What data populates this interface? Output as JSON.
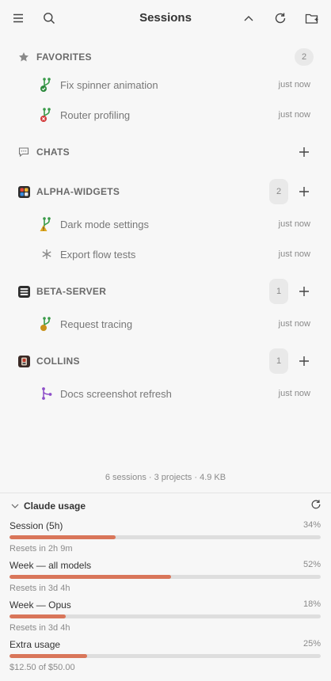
{
  "header": {
    "title": "Sessions"
  },
  "sections": [
    {
      "key": "favorites",
      "label": "FAVORITES",
      "count": "2",
      "items": [
        {
          "label": "Fix spinner animation",
          "time": "just now",
          "icon": "branch-check-icon"
        },
        {
          "label": "Router profiling",
          "time": "just now",
          "icon": "branch-error-icon"
        }
      ]
    },
    {
      "key": "chats",
      "label": "CHATS",
      "items": []
    },
    {
      "key": "alpha",
      "label": "ALPHA-WIDGETS",
      "count": "2",
      "items": [
        {
          "label": "Dark mode settings",
          "time": "just now",
          "icon": "branch-warning-icon"
        },
        {
          "label": "Export flow tests",
          "time": "just now",
          "icon": "asterisk-icon"
        }
      ]
    },
    {
      "key": "beta",
      "label": "BETA-SERVER",
      "count": "1",
      "items": [
        {
          "label": "Request tracing",
          "time": "just now",
          "icon": "branch-pending-icon"
        }
      ]
    },
    {
      "key": "collins",
      "label": "COLLINS",
      "count": "1",
      "items": [
        {
          "label": "Docs screenshot refresh",
          "time": "just now",
          "icon": "merge-icon"
        }
      ]
    }
  ],
  "footer": {
    "stats": "6 sessions · 3 projects · 4.9 KB"
  },
  "usage": {
    "title": "Claude usage",
    "meters": [
      {
        "label": "Session (5h)",
        "percent_text": "34%",
        "fraction": 0.34,
        "sub": "Resets in 2h 9m"
      },
      {
        "label": "Week — all models",
        "percent_text": "52%",
        "fraction": 0.52,
        "sub": "Resets in 3d 4h"
      },
      {
        "label": "Week — Opus",
        "percent_text": "18%",
        "fraction": 0.18,
        "sub": "Resets in 3d 4h"
      },
      {
        "label": "Extra usage",
        "percent_text": "25%",
        "fraction": 0.25,
        "sub": "$12.50 of $50.00"
      }
    ],
    "bar_color": "#d9765a"
  }
}
